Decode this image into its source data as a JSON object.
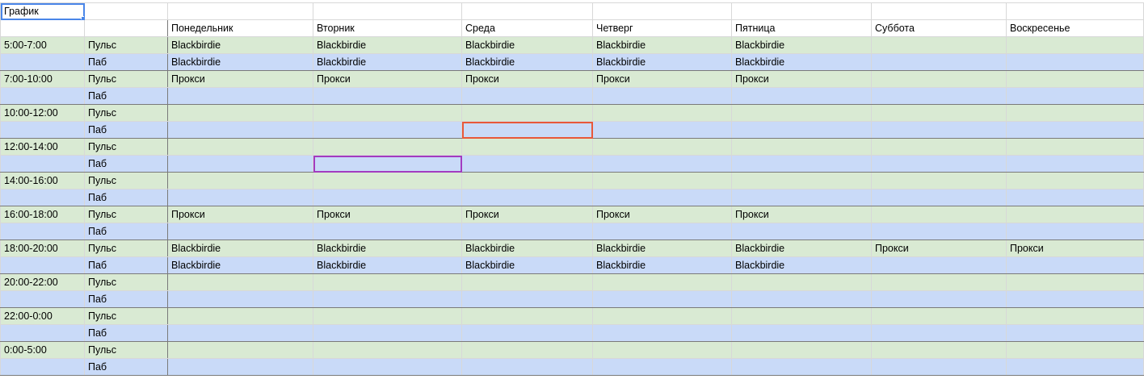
{
  "sheet": {
    "title_cell": "График",
    "header": [
      "",
      "",
      "Понедельник",
      "Вторник",
      "Среда",
      "Четверг",
      "Пятница",
      "Суббота",
      "Воскресенье"
    ],
    "rows": [
      [
        "5:00-7:00",
        "Пульс",
        "Blackbirdie",
        "Blackbirdie",
        "Blackbirdie",
        "Blackbirdie",
        "Blackbirdie",
        "",
        ""
      ],
      [
        "",
        "Паб",
        "Blackbirdie",
        "Blackbirdie",
        "Blackbirdie",
        "Blackbirdie",
        "Blackbirdie",
        "",
        ""
      ],
      [
        "7:00-10:00",
        "Пульс",
        "Прокси",
        "Прокси",
        "Прокси",
        "Прокси",
        "Прокси",
        "",
        ""
      ],
      [
        "",
        "Паб",
        "",
        "",
        "",
        "",
        "",
        "",
        ""
      ],
      [
        "10:00-12:00",
        "Пульс",
        "",
        "",
        "",
        "",
        "",
        "",
        ""
      ],
      [
        "",
        "Паб",
        "",
        "",
        "",
        "",
        "",
        "",
        ""
      ],
      [
        "12:00-14:00",
        "Пульс",
        "",
        "",
        "",
        "",
        "",
        "",
        ""
      ],
      [
        "",
        "Паб",
        "",
        "",
        "",
        "",
        "",
        "",
        ""
      ],
      [
        "14:00-16:00",
        "Пульс",
        "",
        "",
        "",
        "",
        "",
        "",
        ""
      ],
      [
        "",
        "Паб",
        "",
        "",
        "",
        "",
        "",
        "",
        ""
      ],
      [
        "16:00-18:00",
        "Пульс",
        "Прокси",
        "Прокси",
        "Прокси",
        "Прокси",
        "Прокси",
        "",
        ""
      ],
      [
        "",
        "Паб",
        "",
        "",
        "",
        "",
        "",
        "",
        ""
      ],
      [
        "18:00-20:00",
        "Пульс",
        "Blackbirdie",
        "Blackbirdie",
        "Blackbirdie",
        "Blackbirdie",
        "Blackbirdie",
        "Прокси",
        "Прокси"
      ],
      [
        "",
        "Паб",
        "Blackbirdie",
        "Blackbirdie",
        "Blackbirdie",
        "Blackbirdie",
        "Blackbirdie",
        "",
        ""
      ],
      [
        "20:00-22:00",
        "Пульс",
        "",
        "",
        "",
        "",
        "",
        "",
        ""
      ],
      [
        "",
        "Паб",
        "",
        "",
        "",
        "",
        "",
        "",
        ""
      ],
      [
        "22:00-0:00",
        "Пульс",
        "",
        "",
        "",
        "",
        "",
        "",
        ""
      ],
      [
        "",
        "Паб",
        "",
        "",
        "",
        "",
        "",
        "",
        ""
      ],
      [
        "0:00-5:00",
        "Пульс",
        "",
        "",
        "",
        "",
        "",
        "",
        ""
      ],
      [
        "",
        "Паб",
        "",
        "",
        "",
        "",
        "",
        "",
        ""
      ]
    ]
  },
  "colors": {
    "pulse_row": "#d9ead3",
    "pub_row": "#c9daf8",
    "active_selection": "#4a86e8",
    "collaborator_1": "#e8583a",
    "collaborator_2": "#a33bc0"
  }
}
